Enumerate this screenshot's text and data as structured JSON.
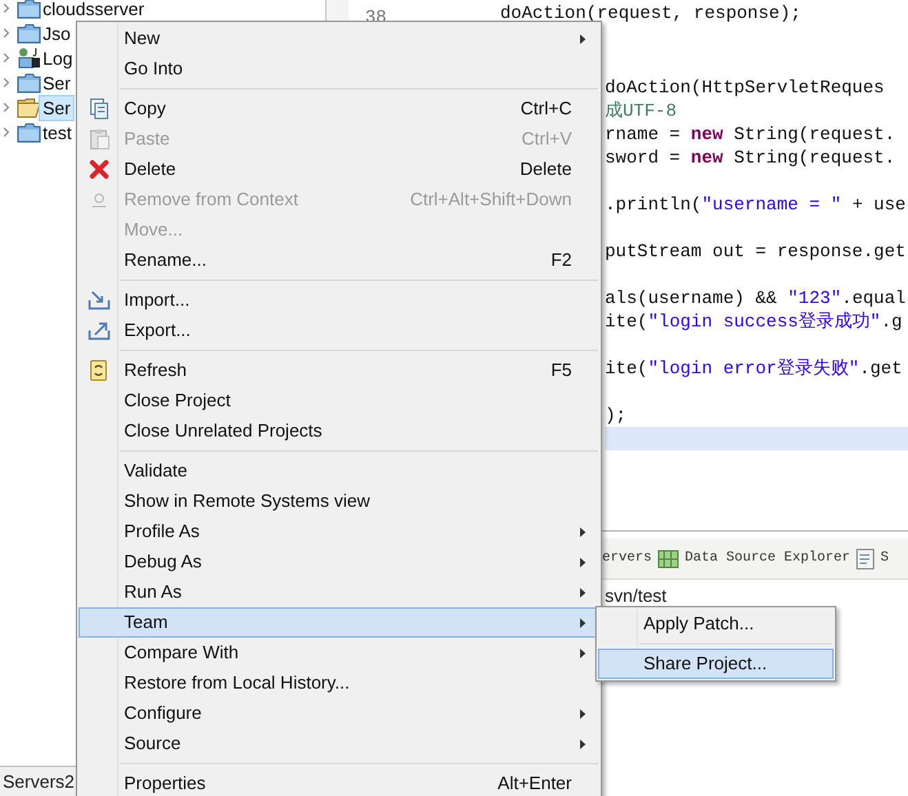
{
  "project_explorer": {
    "items": [
      {
        "label": "cloudsserver",
        "selected": false
      },
      {
        "label": "Jso",
        "selected": false
      },
      {
        "label": "Log",
        "selected": false
      },
      {
        "label": "Ser",
        "selected": false
      },
      {
        "label": "Ser",
        "selected": true
      },
      {
        "label": "test",
        "selected": false
      }
    ]
  },
  "editor": {
    "line_number": "38",
    "lines": [
      {
        "current": false,
        "tokens": [
          {
            "text": "doAction(request, response);",
            "kind": "plain"
          }
        ]
      },
      {
        "current": false
      },
      {
        "current": false
      },
      {
        "current": false,
        "tokens": [
          {
            "text": "doAction(HttpServletReques",
            "kind": "plain"
          }
        ]
      },
      {
        "current": false,
        "tokens": [
          {
            "text": "成UTF-8",
            "kind": "comment"
          }
        ]
      },
      {
        "current": false,
        "tokens": [
          {
            "text": "rname = ",
            "kind": "plain"
          },
          {
            "text": "new",
            "kind": "keyword"
          },
          {
            "text": " String(request.",
            "kind": "plain"
          }
        ]
      },
      {
        "current": false,
        "tokens": [
          {
            "text": "sword = ",
            "kind": "plain"
          },
          {
            "text": "new",
            "kind": "keyword"
          },
          {
            "text": " String(request.",
            "kind": "plain"
          }
        ]
      },
      {
        "current": false
      },
      {
        "current": false,
        "tokens": [
          {
            "text": ".println(",
            "kind": "plain"
          },
          {
            "text": "\"username = \"",
            "kind": "string"
          },
          {
            "text": " + use",
            "kind": "plain"
          }
        ]
      },
      {
        "current": false
      },
      {
        "current": false,
        "tokens": [
          {
            "text": "putStream out = response.get",
            "kind": "plain"
          }
        ]
      },
      {
        "current": false
      },
      {
        "current": false,
        "tokens": [
          {
            "text": "als(username) && ",
            "kind": "plain"
          },
          {
            "text": "\"123\"",
            "kind": "string"
          },
          {
            "text": ".equal",
            "kind": "plain"
          }
        ]
      },
      {
        "current": false,
        "tokens": [
          {
            "text": "ite(",
            "kind": "plain"
          },
          {
            "text": "\"login success登录成功\"",
            "kind": "string"
          },
          {
            "text": ".g",
            "kind": "plain"
          }
        ]
      },
      {
        "current": false
      },
      {
        "current": false,
        "tokens": [
          {
            "text": "ite(",
            "kind": "plain"
          },
          {
            "text": "\"login error登录失败\"",
            "kind": "string"
          },
          {
            "text": ".get",
            "kind": "plain"
          }
        ]
      },
      {
        "current": false
      },
      {
        "current": false,
        "tokens": [
          {
            "text": ");",
            "kind": "plain"
          }
        ]
      },
      {
        "current": true
      }
    ]
  },
  "bottom_panel": {
    "tabs": [
      {
        "label": "ervers"
      },
      {
        "label": "Data Source Explorer"
      },
      {
        "label": "S"
      }
    ],
    "path": "svn/test"
  },
  "left_bottom_tab": "Servers2",
  "context_menu": {
    "items": [
      {
        "kind": "item",
        "label": "New",
        "submenu": true,
        "disabled": false,
        "selected": false
      },
      {
        "kind": "item",
        "label": "Go Into",
        "submenu": false,
        "disabled": false,
        "selected": false
      },
      {
        "kind": "separator"
      },
      {
        "kind": "item",
        "label": "Copy",
        "shortcut": "Ctrl+C",
        "submenu": false,
        "disabled": false,
        "selected": false
      },
      {
        "kind": "item",
        "label": "Paste",
        "shortcut": "Ctrl+V",
        "submenu": false,
        "disabled": true,
        "selected": false
      },
      {
        "kind": "item",
        "label": "Delete",
        "shortcut": "Delete",
        "submenu": false,
        "disabled": false,
        "selected": false
      },
      {
        "kind": "item",
        "label": "Remove from Context",
        "shortcut": "Ctrl+Alt+Shift+Down",
        "submenu": false,
        "disabled": true,
        "selected": false
      },
      {
        "kind": "item",
        "label": "Move...",
        "submenu": false,
        "disabled": true,
        "selected": false
      },
      {
        "kind": "item",
        "label": "Rename...",
        "shortcut": "F2",
        "submenu": false,
        "disabled": false,
        "selected": false
      },
      {
        "kind": "separator"
      },
      {
        "kind": "item",
        "label": "Import...",
        "submenu": false,
        "disabled": false,
        "selected": false
      },
      {
        "kind": "item",
        "label": "Export...",
        "submenu": false,
        "disabled": false,
        "selected": false
      },
      {
        "kind": "separator"
      },
      {
        "kind": "item",
        "label": "Refresh",
        "shortcut": "F5",
        "submenu": false,
        "disabled": false,
        "selected": false
      },
      {
        "kind": "item",
        "label": "Close Project",
        "submenu": false,
        "disabled": false,
        "selected": false
      },
      {
        "kind": "item",
        "label": "Close Unrelated Projects",
        "submenu": false,
        "disabled": false,
        "selected": false
      },
      {
        "kind": "separator"
      },
      {
        "kind": "item",
        "label": "Validate",
        "submenu": false,
        "disabled": false,
        "selected": false
      },
      {
        "kind": "item",
        "label": "Show in Remote Systems view",
        "submenu": false,
        "disabled": false,
        "selected": false
      },
      {
        "kind": "item",
        "label": "Profile As",
        "submenu": true,
        "disabled": false,
        "selected": false
      },
      {
        "kind": "item",
        "label": "Debug As",
        "submenu": true,
        "disabled": false,
        "selected": false
      },
      {
        "kind": "item",
        "label": "Run As",
        "submenu": true,
        "disabled": false,
        "selected": false
      },
      {
        "kind": "item",
        "label": "Team",
        "submenu": true,
        "disabled": false,
        "selected": true
      },
      {
        "kind": "item",
        "label": "Compare With",
        "submenu": true,
        "disabled": false,
        "selected": false
      },
      {
        "kind": "item",
        "label": "Restore from Local History...",
        "submenu": false,
        "disabled": false,
        "selected": false
      },
      {
        "kind": "item",
        "label": "Configure",
        "submenu": true,
        "disabled": false,
        "selected": false
      },
      {
        "kind": "item",
        "label": "Source",
        "submenu": true,
        "disabled": false,
        "selected": false
      },
      {
        "kind": "separator"
      },
      {
        "kind": "item",
        "label": "Properties",
        "shortcut": "Alt+Enter",
        "submenu": false,
        "disabled": false,
        "selected": false
      }
    ]
  },
  "team_submenu": {
    "items": [
      {
        "kind": "item",
        "label": "Apply Patch...",
        "selected": false
      },
      {
        "kind": "separator"
      },
      {
        "kind": "item",
        "label": "Share Project...",
        "selected": true
      }
    ]
  }
}
